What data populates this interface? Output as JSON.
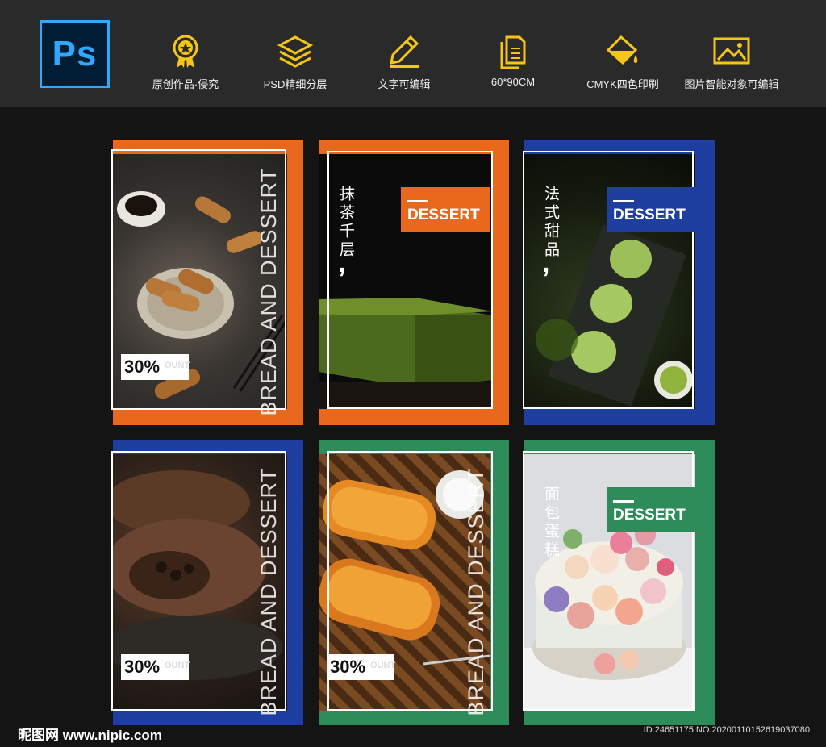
{
  "header": {
    "logo_text": "Ps",
    "features": [
      {
        "icon": "award-ribbon-icon",
        "label": "原创作品·侵究"
      },
      {
        "icon": "layers-icon",
        "label": "PSD精细分层"
      },
      {
        "icon": "pencil-edit-icon",
        "label": "文字可编辑"
      },
      {
        "icon": "document-size-icon",
        "label": "60*90CM"
      },
      {
        "icon": "paint-bucket-icon",
        "label": "CMYK四色印刷"
      },
      {
        "icon": "image-icon",
        "label": "图片智能对象可编辑"
      }
    ]
  },
  "colors": {
    "orange": "#e8681c",
    "blue": "#1e3ea0",
    "green": "#2e8c5b",
    "ps_blue": "#31a8ff"
  },
  "cards": [
    {
      "vertical_text": "BREAD AND DESSERT",
      "discount": "30%",
      "discount_ghost": "OUNT"
    },
    {
      "chinese_title": "抹茶千层",
      "comma": ",",
      "tag": "DESSERT"
    },
    {
      "chinese_title": "法式甜品",
      "comma": ",",
      "tag": "DESSERT"
    },
    {
      "vertical_text": "BREAD AND DESSERT",
      "discount": "30%",
      "discount_ghost": "OUNT"
    },
    {
      "vertical_text": "BREAD AND DESSERT",
      "discount": "30%",
      "discount_ghost": "OUNT"
    },
    {
      "chinese_title": "面包蛋糕",
      "tag": "DESSERT"
    }
  ],
  "footer": {
    "left": "昵图网 www.nipic.com",
    "right": "ID:24651175 NO:20200110152619037080"
  }
}
